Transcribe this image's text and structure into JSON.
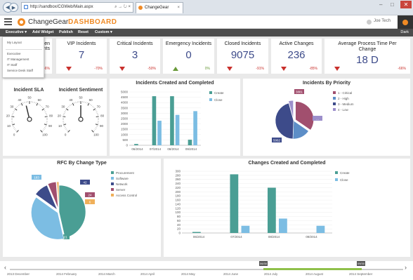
{
  "browser": {
    "url": "http://sandbox/CGWeb/Main.aspx",
    "url_tools": "⌕ → ↻ ×",
    "tab_title": "ChangeGear",
    "tab_close": "×",
    "back": "◀",
    "forward": "▶",
    "win_min": "–",
    "win_max": "□",
    "win_close": "✕"
  },
  "app": {
    "logo": "ChangeGear",
    "title": "DASHBOARD",
    "user": "Joe Tech"
  },
  "toolbar": {
    "executive": "Executive ▾",
    "add_widget": "Add Widget",
    "publish": "Publish",
    "reset": "Reset",
    "custom": "Custom ▾",
    "dark": "Dark"
  },
  "dropdown": {
    "my_layout": "My Layout",
    "items": [
      "Executive",
      "IT Management",
      "IT Staff",
      "Service Desk Staff"
    ]
  },
  "tiles": [
    {
      "title": "Open Incidents",
      "value": "",
      "pct": "-6%",
      "dir": "down"
    },
    {
      "title": "VIP Incidents",
      "value": "7",
      "pct": "-70%",
      "dir": "down"
    },
    {
      "title": "Critical Incidents",
      "value": "3",
      "pct": "-50%",
      "dir": "down"
    },
    {
      "title": "Emergency Incidents",
      "value": "0",
      "pct": "0%",
      "dir": "up"
    },
    {
      "title": "Closed Incidents",
      "value": "9075",
      "pct": "-91%",
      "dir": "down"
    },
    {
      "title": "Active Changes",
      "value": "236",
      "pct": "-85%",
      "dir": "down"
    },
    {
      "title": "Average Process Time Per Change",
      "value": "18 D",
      "pct": "-66%",
      "dir": "down"
    }
  ],
  "panels": {
    "sla": "Incident SLA",
    "sentiment": "Incident Sentiment",
    "created_closed": "Incidents Created and Completed",
    "priority": "Incidents By Priority",
    "rfc": "RFC By Change Type",
    "changes": "Changes Created and Completed"
  },
  "gauges": {
    "sla": {
      "value": 45,
      "max": 100,
      "ticks": [
        "0",
        "10",
        "20",
        "30",
        "40",
        "50",
        "60",
        "70",
        "80",
        "90",
        "100"
      ]
    },
    "sentiment": {
      "value": 50,
      "max": 100,
      "ticks": [
        "0",
        "10",
        "20",
        "30",
        "40",
        "50",
        "60",
        "70",
        "80",
        "90",
        "100"
      ]
    }
  },
  "colors": {
    "create": "#4a9e94",
    "close": "#7cbde3",
    "critical": "#a14f6e",
    "high": "#5d8ec7",
    "medium": "#3d4b8a",
    "low": "#9c8fcb",
    "procurement": "#4a9e94",
    "software": "#7cbde3",
    "network": "#3d4b8a",
    "server": "#a14f6e",
    "access_control": "#f0b05a"
  },
  "chart_data": [
    {
      "type": "bar",
      "title": "Incidents Created and Completed",
      "categories": [
        "06/2014",
        "07/2014",
        "08/2014",
        "09/2014"
      ],
      "series": [
        {
          "name": "Create",
          "values": [
            120,
            4600,
            4600,
            520
          ]
        },
        {
          "name": "Close",
          "values": [
            0,
            2300,
            2850,
            3200
          ]
        }
      ],
      "ylim": [
        0,
        5000
      ],
      "yticks": [
        "0",
        "500",
        "1000",
        "1500",
        "2000",
        "2500",
        "3000",
        "3500",
        "4000",
        "4500",
        "5000"
      ],
      "legend": "right"
    },
    {
      "type": "pie",
      "title": "Incidents By Priority",
      "series": [
        {
          "name": "1 - Critical",
          "value": 3881
        },
        {
          "name": "2 - High",
          "value": 1800
        },
        {
          "name": "3 - Medium",
          "value": 5062
        },
        {
          "name": "4 - Low",
          "value": 480
        }
      ],
      "labels": [
        "3881",
        "",
        "5062",
        "..."
      ],
      "legend": "right"
    },
    {
      "type": "pie",
      "title": "RFC By Change Type",
      "series": [
        {
          "name": "Procurement",
          "value": 221
        },
        {
          "name": "Software",
          "value": 183
        },
        {
          "name": "Network",
          "value": 42
        },
        {
          "name": "Server",
          "value": 24
        },
        {
          "name": "Access Control",
          "value": 6
        }
      ],
      "labels": [
        "221",
        "183",
        "42",
        "24",
        "6"
      ],
      "legend": "right"
    },
    {
      "type": "bar",
      "title": "Changes Created and Completed",
      "categories": [
        "06/2014",
        "07/2014",
        "08/2014",
        "09/2014"
      ],
      "series": [
        {
          "name": "Create",
          "values": [
            5,
            285,
            220,
            0
          ]
        },
        {
          "name": "Close",
          "values": [
            0,
            35,
            70,
            35
          ]
        }
      ],
      "ylim": [
        0,
        300
      ],
      "yticks": [
        "0",
        "20",
        "40",
        "60",
        "80",
        "100",
        "120",
        "140",
        "160",
        "180",
        "200",
        "220",
        "240",
        "260",
        "280",
        "300"
      ],
      "legend": "right"
    }
  ],
  "timeline": {
    "labels": [
      "2013 December",
      "2014 February",
      "2014 March",
      "2014 April",
      "2014 May",
      "2014 June",
      "2014 July",
      "2014 August",
      "2014 September"
    ],
    "start_marker": "06/30",
    "end_marker": "09/30",
    "left_arrow": "‹",
    "right_arrow": "›"
  }
}
